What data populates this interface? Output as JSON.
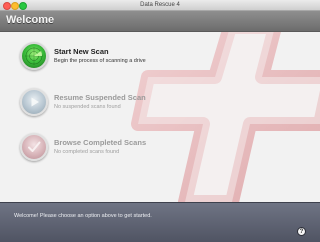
{
  "window": {
    "title": "Data Rescue 4"
  },
  "header": {
    "title": "Welcome"
  },
  "options": [
    {
      "title": "Start New Scan",
      "subtitle": "Begin the process of scanning a drive",
      "icon": "radar-icon",
      "enabled": true,
      "color": "#3cbf3c"
    },
    {
      "title": "Resume Suspended Scan",
      "subtitle": "No suspended scans found",
      "icon": "play-icon",
      "enabled": false,
      "color": "#b7c6d1"
    },
    {
      "title": "Browse Completed Scans",
      "subtitle": "No completed scans found",
      "icon": "checkmark-icon",
      "enabled": false,
      "color": "#d7b3b8"
    }
  ],
  "status": {
    "message": "Welcome! Please choose an option above to get started.",
    "help_label": "?"
  },
  "colors": {
    "logo_red": "#e0a9ac",
    "header_gray": "#7d7d7d",
    "statusbar": "#5b5f6e"
  }
}
